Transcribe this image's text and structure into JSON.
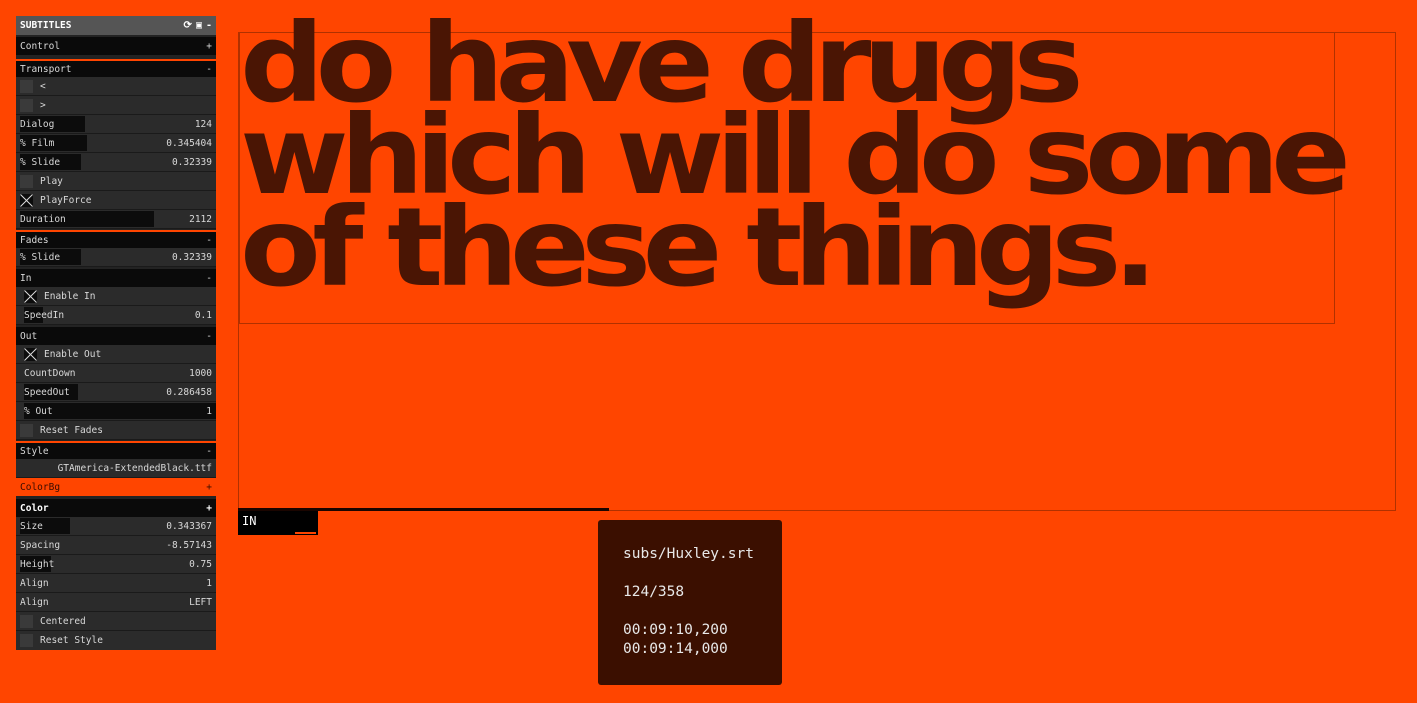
{
  "panel": {
    "title": "SUBTITLES",
    "header_icons": [
      "refresh-icon",
      "save-icon",
      "collapse-icon"
    ],
    "collapse": "-",
    "control": {
      "label": "Control",
      "toggle": "+"
    },
    "transport": {
      "label": "Transport",
      "toggle": "-",
      "prev": "<",
      "next": ">",
      "dialog": {
        "label": "Dialog",
        "value": "124",
        "fill": 0.34
      },
      "film": {
        "label": "% Film",
        "value": "0.345404",
        "fill": 0.35
      },
      "slide": {
        "label": "% Slide",
        "value": "0.32339",
        "fill": 0.32
      },
      "play": "Play",
      "playforce": "PlayForce",
      "duration": {
        "label": "Duration",
        "value": "2112",
        "fill": 0.7
      }
    },
    "fades": {
      "label": "Fades",
      "toggle": "-",
      "slide": {
        "label": "% Slide",
        "value": "0.32339",
        "fill": 0.32
      },
      "in": {
        "label": "In",
        "toggle": "-",
        "enable": "Enable In",
        "speed": {
          "label": "SpeedIn",
          "value": "0.1",
          "fill": 0.1
        }
      },
      "out": {
        "label": "Out",
        "toggle": "-",
        "enable": "Enable Out",
        "countdown": {
          "label": "CountDown",
          "value": "1000",
          "fill": 0.0
        },
        "speed": {
          "label": "SpeedOut",
          "value": "0.286458",
          "fill": 0.28
        },
        "pct": {
          "label": "% Out",
          "value": "1",
          "fill": 1.0
        }
      },
      "reset": "Reset Fades"
    },
    "style": {
      "label": "Style",
      "toggle": "-",
      "font": "GTAmerica-ExtendedBlack.ttf",
      "colorbg": {
        "label": "ColorBg",
        "toggle": "+"
      },
      "color": {
        "label": "Color",
        "toggle": "+"
      },
      "size": {
        "label": "Size",
        "value": "0.343367",
        "fill": 0.26
      },
      "spacing": {
        "label": "Spacing",
        "value": "-8.57143",
        "fill": 0.0
      },
      "height": {
        "label": "Height",
        "value": "0.75",
        "fill": 0.16
      },
      "align1": {
        "label": "Align",
        "value": "1"
      },
      "align2": {
        "label": "Align",
        "value": "LEFT"
      },
      "centered": "Centered",
      "reset": "Reset Style"
    }
  },
  "stage": {
    "subtitle": "do have drugs\nwhich will do some\nof these things.",
    "progress": 0.32,
    "tag": "IN"
  },
  "info": {
    "file": "subs/Huxley.srt",
    "count": "124/358",
    "start": "00:09:10,200",
    "end": "00:09:14,000"
  },
  "colors": {
    "background": "#ff4500",
    "text": "#4a1504",
    "panel": "#232323",
    "info_bg": "#3b0f00"
  }
}
